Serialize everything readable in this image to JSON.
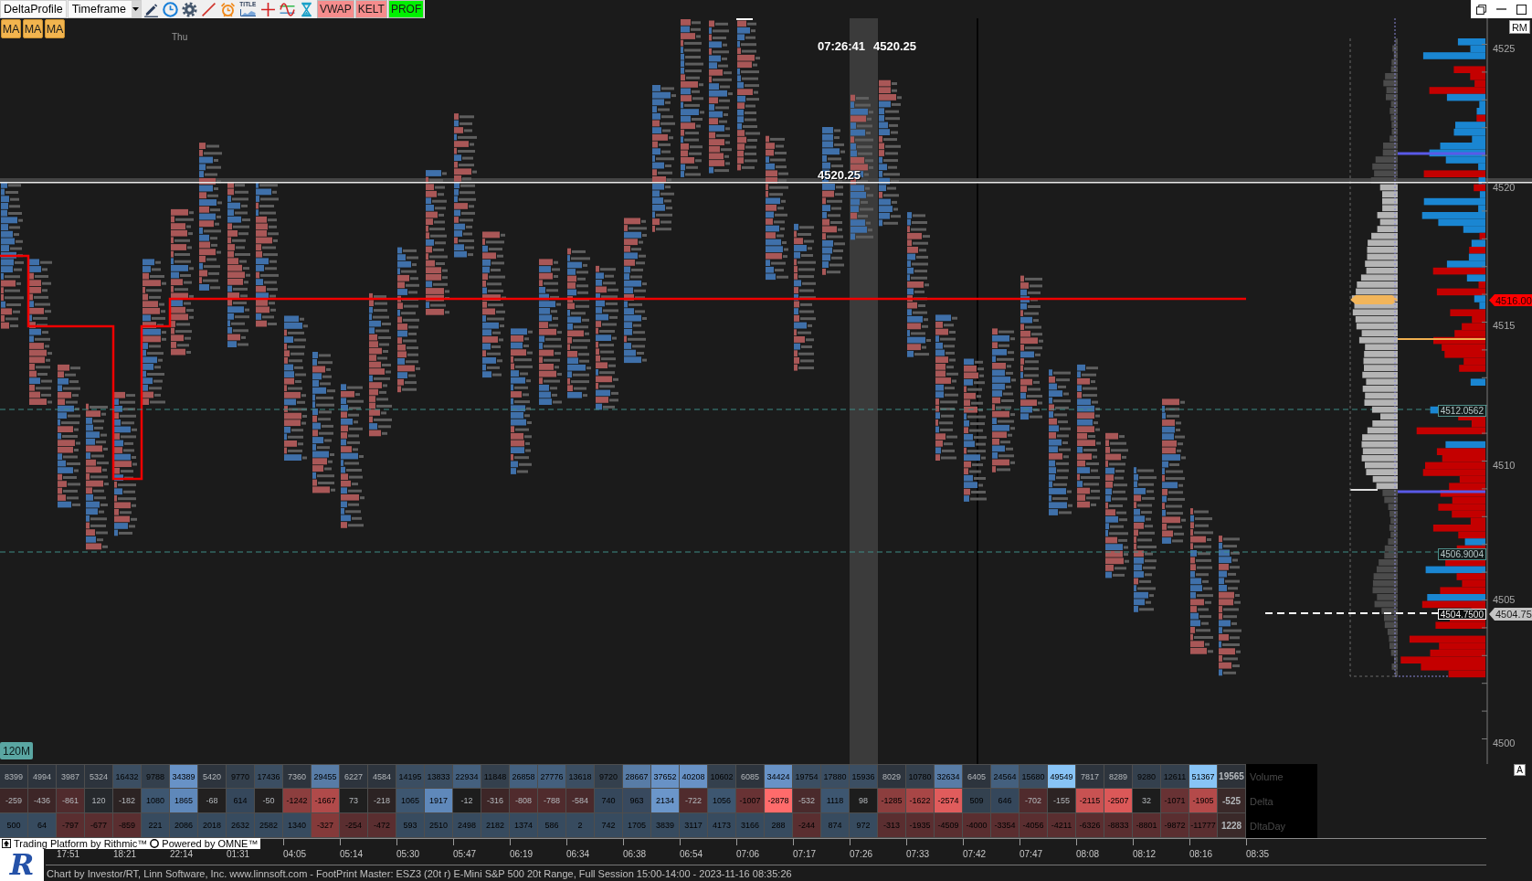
{
  "toolbar": {
    "profile_button": "DeltaProfile",
    "timeframe_dropdown": "Timeframe",
    "title_tool": "TITLE",
    "indicator_buttons": [
      {
        "label": "VWAP",
        "color": "#f58c8c"
      },
      {
        "label": "KELT",
        "color": "#f58c8c"
      },
      {
        "label": "PROF",
        "color": "#00f000"
      }
    ]
  },
  "study_buttons": [
    "MA",
    "MA",
    "MA"
  ],
  "day_label": "Thu",
  "crosshair": {
    "readout_time": "07:26:41",
    "readout_price": "4520.25",
    "price_label": "4520.25"
  },
  "price_axis": {
    "corner_button": "RM",
    "ticks": [
      "4525",
      "4520",
      "4515",
      "4510",
      "4505",
      "4500"
    ],
    "scale_button": "A"
  },
  "price_markers": [
    {
      "kind": "alert",
      "text": "4516.00"
    },
    {
      "kind": "level",
      "text": "4512.0562"
    },
    {
      "kind": "level",
      "text": "4506.9004"
    },
    {
      "kind": "order",
      "text": "4504.7500"
    },
    {
      "kind": "last",
      "text": "4504.75"
    }
  ],
  "bar_period": "120M",
  "stats_table": {
    "rows": [
      {
        "label": "Volume",
        "cells": [
          {
            "text": "8399",
            "color": "#2d343d"
          },
          {
            "text": "4994",
            "color": "#2d343d"
          },
          {
            "text": "3987",
            "color": "#2d343d"
          },
          {
            "text": "5324",
            "color": "#2d343d"
          },
          {
            "text": "16432",
            "color": "#3b4e62"
          },
          {
            "text": "9788",
            "color": "#34404d"
          },
          {
            "text": "34389",
            "color": "#6892c6"
          },
          {
            "text": "5420",
            "color": "#2d343d"
          },
          {
            "text": "9770",
            "color": "#34404d"
          },
          {
            "text": "17436",
            "color": "#3b4e62"
          },
          {
            "text": "7360",
            "color": "#2d343d"
          },
          {
            "text": "29455",
            "color": "#587ca6"
          },
          {
            "text": "6227",
            "color": "#2d343d"
          },
          {
            "text": "4584",
            "color": "#2d343d"
          },
          {
            "text": "14195",
            "color": "#3b4e62"
          },
          {
            "text": "13833",
            "color": "#3b4e62"
          },
          {
            "text": "22934",
            "color": "#44607e"
          },
          {
            "text": "11848",
            "color": "#34404d"
          },
          {
            "text": "26858",
            "color": "#44607e"
          },
          {
            "text": "27776",
            "color": "#44607e"
          },
          {
            "text": "13618",
            "color": "#3b4e62"
          },
          {
            "text": "9720",
            "color": "#34404d"
          },
          {
            "text": "28667",
            "color": "#587ca6"
          },
          {
            "text": "37652",
            "color": "#6892c6"
          },
          {
            "text": "40208",
            "color": "#6892c6"
          },
          {
            "text": "10602",
            "color": "#34404d"
          },
          {
            "text": "6085",
            "color": "#2d343d"
          },
          {
            "text": "34424",
            "color": "#6892c6"
          },
          {
            "text": "19754",
            "color": "#3b4e62"
          },
          {
            "text": "17880",
            "color": "#3b4e62"
          },
          {
            "text": "15936",
            "color": "#3b4e62"
          },
          {
            "text": "8029",
            "color": "#2d343d"
          },
          {
            "text": "10780",
            "color": "#34404d"
          },
          {
            "text": "32634",
            "color": "#587ca6"
          },
          {
            "text": "6405",
            "color": "#2d343d"
          },
          {
            "text": "24564",
            "color": "#44607e"
          },
          {
            "text": "15680",
            "color": "#3b4e62"
          },
          {
            "text": "49549",
            "color": "#88c4f6"
          },
          {
            "text": "7817",
            "color": "#2d343d"
          },
          {
            "text": "8289",
            "color": "#2d343d"
          },
          {
            "text": "9280",
            "color": "#34404d"
          },
          {
            "text": "12611",
            "color": "#34404d"
          },
          {
            "text": "51367",
            "color": "#88c4f6"
          }
        ],
        "current": {
          "text": "19565",
          "color": "#2d3239"
        }
      },
      {
        "label": "Delta",
        "cells": [
          {
            "text": "-259",
            "color": "#3d2627"
          },
          {
            "text": "-436",
            "color": "#3d2627"
          },
          {
            "text": "-861",
            "color": "#502b2d"
          },
          {
            "text": "120",
            "color": "#26292d"
          },
          {
            "text": "-182",
            "color": "#2c2323"
          },
          {
            "text": "1080",
            "color": "#3d5670"
          },
          {
            "text": "1865",
            "color": "#5f88ba"
          },
          {
            "text": "-68",
            "color": "#222020"
          },
          {
            "text": "614",
            "color": "#35475b"
          },
          {
            "text": "-50",
            "color": "#222020"
          },
          {
            "text": "-1242",
            "color": "#8c3e3e"
          },
          {
            "text": "-1667",
            "color": "#b04a4a"
          },
          {
            "text": "73",
            "color": "#1f1f1f"
          },
          {
            "text": "-218",
            "color": "#2c2323"
          },
          {
            "text": "1065",
            "color": "#3d5670"
          },
          {
            "text": "1917",
            "color": "#5f88ba"
          },
          {
            "text": "-12",
            "color": "#1d1d1d"
          },
          {
            "text": "-316",
            "color": "#3d2627"
          },
          {
            "text": "-808",
            "color": "#502b2d"
          },
          {
            "text": "-788",
            "color": "#502b2d"
          },
          {
            "text": "-584",
            "color": "#4a2a2c"
          },
          {
            "text": "740",
            "color": "#35475b"
          },
          {
            "text": "963",
            "color": "#38495e"
          },
          {
            "text": "2134",
            "color": "#6b96ca"
          },
          {
            "text": "-722",
            "color": "#502b2d"
          },
          {
            "text": "1056",
            "color": "#3d5670"
          },
          {
            "text": "-1007",
            "color": "#683234"
          },
          {
            "text": "-2878",
            "color": "#ff6b6b"
          },
          {
            "text": "-532",
            "color": "#4a2a2c"
          },
          {
            "text": "1118",
            "color": "#3d5670"
          },
          {
            "text": "98",
            "color": "#1d1d1d"
          },
          {
            "text": "-1285",
            "color": "#8c3e3e"
          },
          {
            "text": "-1622",
            "color": "#a84646"
          },
          {
            "text": "-2574",
            "color": "#e05c5c"
          },
          {
            "text": "509",
            "color": "#33414f"
          },
          {
            "text": "646",
            "color": "#35475b"
          },
          {
            "text": "-702",
            "color": "#502b2d"
          },
          {
            "text": "-155",
            "color": "#2c2323"
          },
          {
            "text": "-2115",
            "color": "#c85252"
          },
          {
            "text": "-2507",
            "color": "#db5858"
          },
          {
            "text": "32",
            "color": "#1d1d1d"
          },
          {
            "text": "-1071",
            "color": "#683234"
          },
          {
            "text": "-1905",
            "color": "#b44a4a"
          }
        ],
        "current": {
          "text": "-525",
          "color": "#3a2929"
        }
      },
      {
        "label": "DltaDay",
        "cells": [
          {
            "text": "500",
            "color": "#374b5f"
          },
          {
            "text": "64",
            "color": "#374b5f"
          },
          {
            "text": "-797",
            "color": "#5a2e30"
          },
          {
            "text": "-677",
            "color": "#5a2e30"
          },
          {
            "text": "-859",
            "color": "#5a2e30"
          },
          {
            "text": "221",
            "color": "#374b5f"
          },
          {
            "text": "2086",
            "color": "#374b5f"
          },
          {
            "text": "2018",
            "color": "#374b5f"
          },
          {
            "text": "2632",
            "color": "#374b5f"
          },
          {
            "text": "2582",
            "color": "#374b5f"
          },
          {
            "text": "1340",
            "color": "#374b5f"
          },
          {
            "text": "-327",
            "color": "#843a3a"
          },
          {
            "text": "-254",
            "color": "#5a2e30"
          },
          {
            "text": "-472",
            "color": "#5a2e30"
          },
          {
            "text": "593",
            "color": "#374b5f"
          },
          {
            "text": "2510",
            "color": "#374b5f"
          },
          {
            "text": "2498",
            "color": "#374b5f"
          },
          {
            "text": "2182",
            "color": "#374b5f"
          },
          {
            "text": "1374",
            "color": "#374b5f"
          },
          {
            "text": "586",
            "color": "#374b5f"
          },
          {
            "text": "2",
            "color": "#374b5f"
          },
          {
            "text": "742",
            "color": "#374b5f"
          },
          {
            "text": "1705",
            "color": "#374b5f"
          },
          {
            "text": "3839",
            "color": "#374b5f"
          },
          {
            "text": "3117",
            "color": "#374b5f"
          },
          {
            "text": "4173",
            "color": "#374b5f"
          },
          {
            "text": "3166",
            "color": "#374b5f"
          },
          {
            "text": "288",
            "color": "#374b5f"
          },
          {
            "text": "-244",
            "color": "#5a2e30"
          },
          {
            "text": "874",
            "color": "#374b5f"
          },
          {
            "text": "972",
            "color": "#374b5f"
          },
          {
            "text": "-313",
            "color": "#5a2e30"
          },
          {
            "text": "-1935",
            "color": "#5a2e30"
          },
          {
            "text": "-4509",
            "color": "#5a2e30"
          },
          {
            "text": "-4000",
            "color": "#5a2e30"
          },
          {
            "text": "-3354",
            "color": "#5a2e30"
          },
          {
            "text": "-4056",
            "color": "#5a2e30"
          },
          {
            "text": "-4211",
            "color": "#5a2e30"
          },
          {
            "text": "-6326",
            "color": "#5a2e30"
          },
          {
            "text": "-8833",
            "color": "#5a2e30"
          },
          {
            "text": "-8801",
            "color": "#5a2e30"
          },
          {
            "text": "-9872",
            "color": "#5a2e30"
          },
          {
            "text": "-11777",
            "color": "#5a2e30"
          }
        ],
        "current": {
          "text": "1228",
          "color": "#3a2929"
        }
      }
    ]
  },
  "vendor_badge": {
    "platform": "Trading Platform by Rithmic™",
    "powered": "Powered by OMNE™"
  },
  "logo": "R",
  "time_axis": [
    "17:51",
    "18:21",
    "22:14",
    "01:31",
    "04:05",
    "05:14",
    "05:30",
    "05:47",
    "06:19",
    "06:34",
    "06:38",
    "06:54",
    "07:06",
    "07:17",
    "07:26",
    "07:33",
    "07:42",
    "07:47",
    "08:08",
    "08:12",
    "08:16",
    "08:35"
  ],
  "status_bar": "Chart by Investor/RT, Linn Software, Inc. www.linnsoft.com - FootPrint Master: ESZ3 (20t r) E-Mini S&P 500 20t Range, Full Session 15:00-14:00 - 2023-11-16 08:35:26"
}
